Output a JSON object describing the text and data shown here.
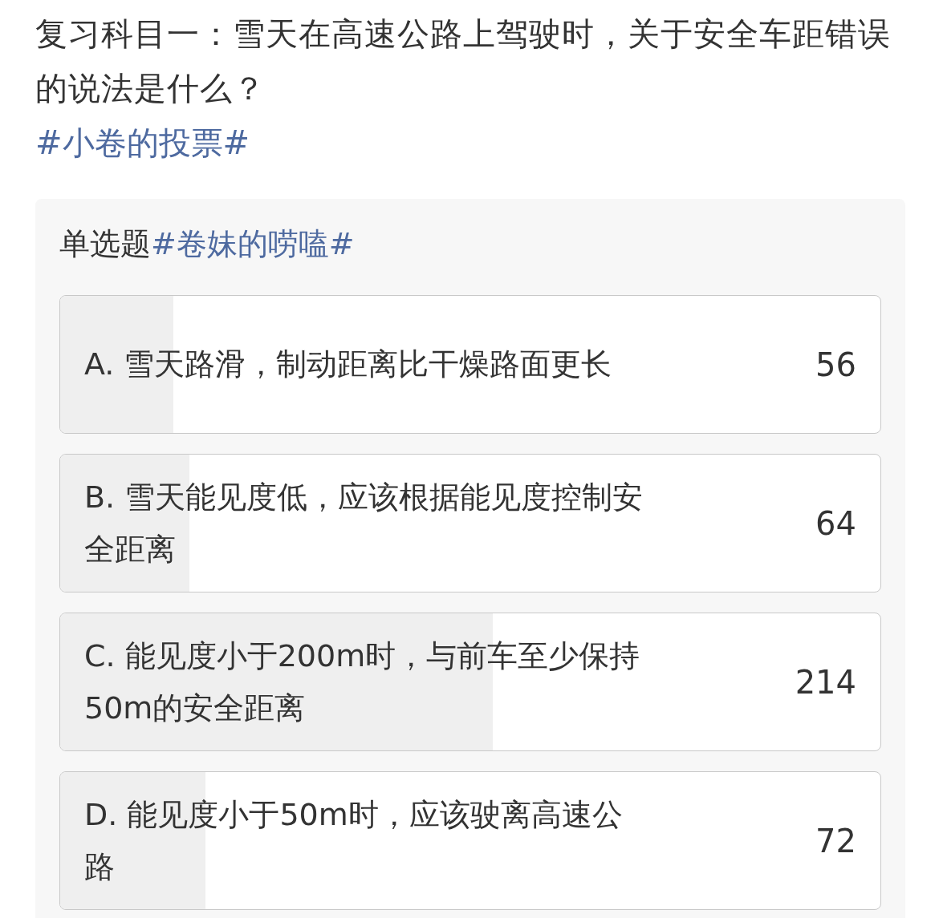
{
  "post": {
    "text": "复习科目一：雪天在高速公路上驾驶时，关于安全车距错误的说法是什么？",
    "topic": "#小卷的投票#"
  },
  "poll": {
    "type_label": "单选题",
    "tag": "#卷妹的唠嗑#",
    "options": [
      {
        "label": "A. 雪天路滑，制动距离比干燥路面更长",
        "count": "56",
        "level": 0.138
      },
      {
        "label": "B. 雪天能见度低，应该根据能见度控制安全距离",
        "count": "64",
        "level": 0.158
      },
      {
        "label": "C. 能见度小于200m时，与前车至少保持50m的安全距离",
        "count": "214",
        "level": 0.527
      },
      {
        "label": "D. 能见度小于50m时，应该驶离高速公路",
        "count": "72",
        "level": 0.177
      }
    ]
  }
}
